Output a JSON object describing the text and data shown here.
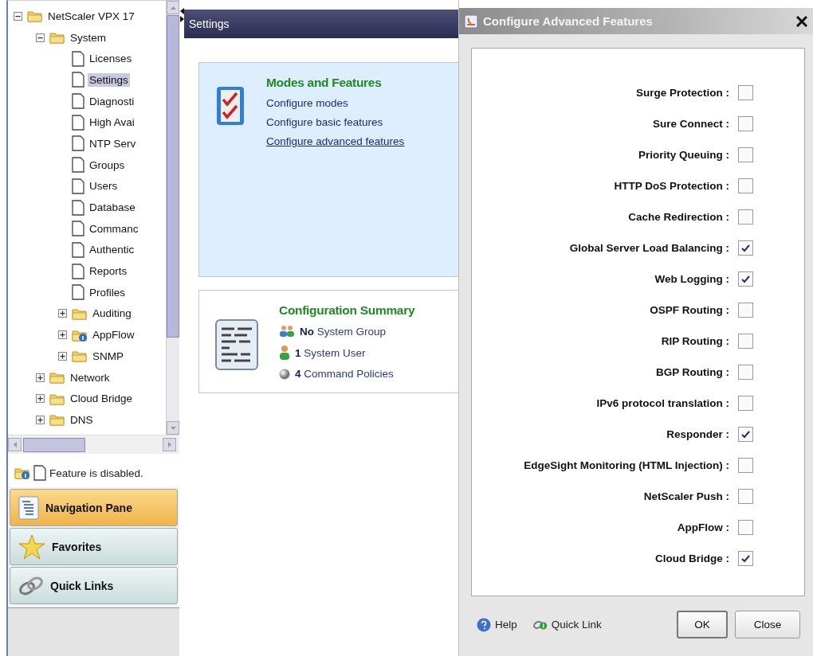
{
  "tree": {
    "nodes": [
      {
        "label": "NetScaler VPX 17",
        "kind": "folder",
        "expanded": true,
        "selected": false,
        "children": [
          {
            "label": "System",
            "kind": "folder",
            "expanded": true,
            "selected": false,
            "children": [
              {
                "label": "Licenses",
                "kind": "page",
                "selected": false
              },
              {
                "label": "Settings",
                "kind": "page",
                "selected": true
              },
              {
                "label": "Diagnosti",
                "kind": "page",
                "selected": false
              },
              {
                "label": "High Avai",
                "kind": "page",
                "selected": false
              },
              {
                "label": "NTP Serv",
                "kind": "page",
                "selected": false
              },
              {
                "label": "Groups",
                "kind": "page",
                "selected": false
              },
              {
                "label": "Users",
                "kind": "page",
                "selected": false
              },
              {
                "label": "Database",
                "kind": "page",
                "selected": false
              },
              {
                "label": "Commanc",
                "kind": "page",
                "selected": false
              },
              {
                "label": "Authentic",
                "kind": "page",
                "selected": false
              },
              {
                "label": "Reports",
                "kind": "page",
                "selected": false
              },
              {
                "label": "Profiles",
                "kind": "page",
                "selected": false
              },
              {
                "label": "Auditing",
                "kind": "folder",
                "expanded": false,
                "selected": false
              },
              {
                "label": "AppFlow",
                "kind": "info-folder",
                "expanded": false,
                "selected": false
              },
              {
                "label": "SNMP",
                "kind": "folder",
                "expanded": false,
                "selected": false
              }
            ]
          },
          {
            "label": "Network",
            "kind": "folder",
            "expanded": false,
            "selected": false
          },
          {
            "label": "Cloud Bridge",
            "kind": "folder",
            "expanded": false,
            "selected": false
          },
          {
            "label": "DNS",
            "kind": "folder",
            "expanded": false,
            "selected": false
          }
        ]
      }
    ]
  },
  "legend": {
    "text": "Feature is disabled."
  },
  "nav_buttons": [
    {
      "label": "Navigation Pane",
      "kind": "navigation",
      "selected": true
    },
    {
      "label": "Favorites",
      "kind": "favorites",
      "selected": false
    },
    {
      "label": "Quick Links",
      "kind": "links",
      "selected": false
    }
  ],
  "settings_panel": {
    "title": "Settings",
    "modes_card": {
      "title": "Modes and Features",
      "links": [
        {
          "label": "Configure modes",
          "underlined": false
        },
        {
          "label": "Configure basic features",
          "underlined": false
        },
        {
          "label": "Configure advanced features",
          "underlined": true
        }
      ]
    },
    "summary_card": {
      "title": "Configuration Summary",
      "items": [
        {
          "count": "No",
          "label": "System Group",
          "kind": "group"
        },
        {
          "count": "1",
          "label": "System User",
          "kind": "user"
        },
        {
          "count": "4",
          "label": "Command Policies",
          "kind": "policy"
        }
      ]
    }
  },
  "dialog": {
    "title": "Configure Advanced Features",
    "features": [
      {
        "label": "Surge Protection :",
        "checked": false
      },
      {
        "label": "Sure Connect :",
        "checked": false
      },
      {
        "label": "Priority Queuing :",
        "checked": false
      },
      {
        "label": "HTTP DoS Protection :",
        "checked": false
      },
      {
        "label": "Cache Redirection :",
        "checked": false
      },
      {
        "label": "Global Server Load Balancing :",
        "checked": true
      },
      {
        "label": "Web Logging :",
        "checked": true
      },
      {
        "label": "OSPF Routing :",
        "checked": false
      },
      {
        "label": "RIP Routing :",
        "checked": false
      },
      {
        "label": "BGP Routing :",
        "checked": false
      },
      {
        "label": "IPv6 protocol translation :",
        "checked": false
      },
      {
        "label": "Responder :",
        "checked": true
      },
      {
        "label": "EdgeSight Monitoring (HTML Injection) :",
        "checked": false
      },
      {
        "label": "NetScaler Push :",
        "checked": false
      },
      {
        "label": "AppFlow :",
        "checked": false
      },
      {
        "label": "Cloud Bridge :",
        "checked": true
      }
    ],
    "footer_links": [
      {
        "label": "Help",
        "kind": "help"
      },
      {
        "label": "Quick Link",
        "kind": "quick-link"
      }
    ],
    "buttons": [
      {
        "label": "OK",
        "default": true
      },
      {
        "label": "Close",
        "default": false
      }
    ]
  }
}
